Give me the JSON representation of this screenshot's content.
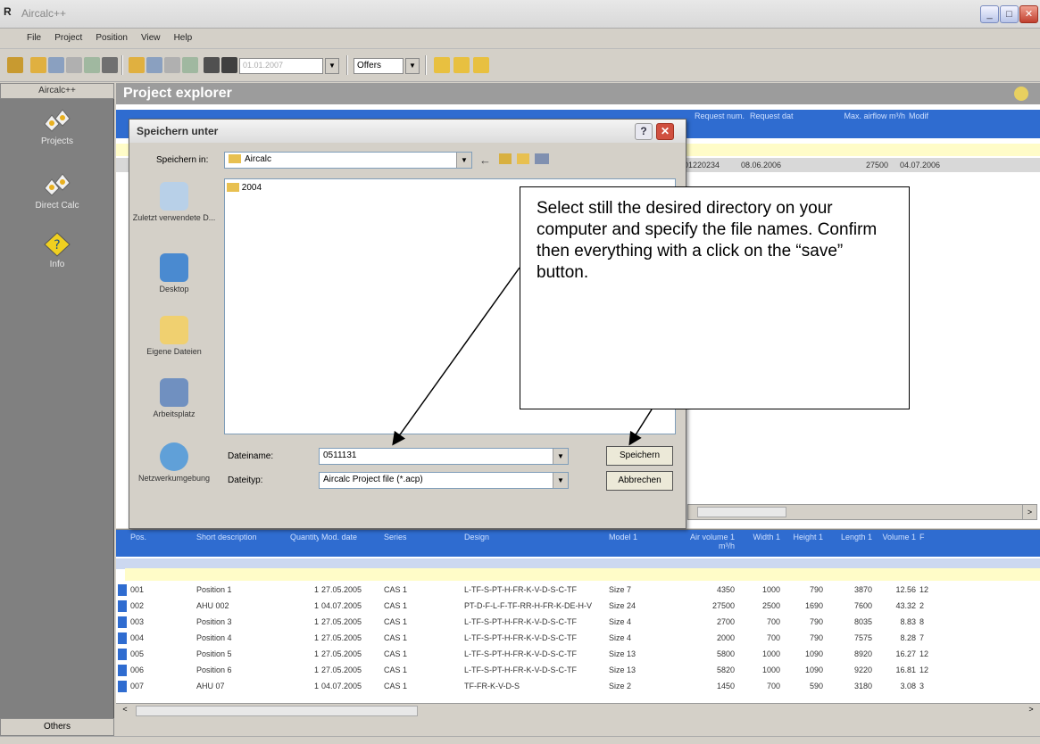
{
  "window": {
    "title": "Aircalc++",
    "app_glyph": "R"
  },
  "menu": [
    "File",
    "Project",
    "Position",
    "View",
    "Help"
  ],
  "toolbar": {
    "date_value": "01.01.2007",
    "offers_label": "Offers"
  },
  "left_panel": {
    "header": "Aircalc++",
    "items": [
      {
        "label": "Projects",
        "icon": "projects-icon"
      },
      {
        "label": "Direct Calc",
        "icon": "direct-calc-icon"
      },
      {
        "label": "Info",
        "icon": "info-icon"
      }
    ],
    "others_label": "Others"
  },
  "project_explorer": {
    "title": "Project explorer",
    "upper_columns": [
      "Request num.",
      "Request dat",
      "Max. airflow m³/h",
      "Modif"
    ],
    "upper_row": [
      "5-01220234",
      "08.06.2006",
      "27500",
      "04.07.2006"
    ]
  },
  "dialog": {
    "title": "Speichern unter",
    "save_in_label": "Speichern in:",
    "save_in_value": "Aircalc",
    "places": [
      "Zuletzt verwendete D...",
      "Desktop",
      "Eigene Dateien",
      "Arbeitsplatz",
      "Netzwerkumgebung"
    ],
    "folders": [
      "2004"
    ],
    "filename_label": "Dateiname:",
    "filename_value": "0511131",
    "filetype_label": "Dateityp:",
    "filetype_value": "Aircalc Project file (*.acp)",
    "save_button": "Speichern",
    "cancel_button": "Abbrechen"
  },
  "callout": {
    "text": "Select still the desired directory on your computer and specify the file names. Confirm then everything with a click on the “save” button."
  },
  "lower_grid": {
    "columns": [
      "Pos.",
      "Short description",
      "Quantity",
      "Mod. date",
      "Series",
      "Design",
      "Model 1",
      "Air volume 1 m³/h",
      "Width 1",
      "Height 1",
      "Length 1",
      "Volume 1",
      "F"
    ],
    "rows": [
      [
        "001",
        "Position 1",
        "1",
        "27.05.2005",
        "CAS 1",
        "L-TF-S-PT-H-FR-K-V-D-S-C-TF",
        "Size 7",
        "4350",
        "1000",
        "790",
        "3870",
        "12.56",
        "12"
      ],
      [
        "002",
        "AHU 002",
        "1",
        "04.07.2005",
        "CAS 1",
        "PT-D-F-L-F-TF-RR-H-FR-K-DE-H-V",
        "Size 24",
        "27500",
        "2500",
        "1690",
        "7600",
        "43.32",
        "2"
      ],
      [
        "003",
        "Position 3",
        "1",
        "27.05.2005",
        "CAS 1",
        "L-TF-S-PT-H-FR-K-V-D-S-C-TF",
        "Size 4",
        "2700",
        "700",
        "790",
        "8035",
        "8.83",
        "8"
      ],
      [
        "004",
        "Position 4",
        "1",
        "27.05.2005",
        "CAS 1",
        "L-TF-S-PT-H-FR-K-V-D-S-C-TF",
        "Size 4",
        "2000",
        "700",
        "790",
        "7575",
        "8.28",
        "7"
      ],
      [
        "005",
        "Position 5",
        "1",
        "27.05.2005",
        "CAS 1",
        "L-TF-S-PT-H-FR-K-V-D-S-C-TF",
        "Size 13",
        "5800",
        "1000",
        "1090",
        "8920",
        "16.27",
        "12"
      ],
      [
        "006",
        "Position 6",
        "1",
        "27.05.2005",
        "CAS 1",
        "L-TF-S-PT-H-FR-K-V-D-S-C-TF",
        "Size 13",
        "5820",
        "1000",
        "1090",
        "9220",
        "16.81",
        "12"
      ],
      [
        "007",
        "AHU 07",
        "1",
        "04.07.2005",
        "CAS 1",
        "TF-FR-K-V-D-S",
        "Size 2",
        "1450",
        "700",
        "590",
        "3180",
        "3.08",
        "3"
      ]
    ]
  },
  "colors": {
    "accent": "#2f6cd0",
    "panel": "#808080",
    "highlight_row": "#fffcc8"
  }
}
